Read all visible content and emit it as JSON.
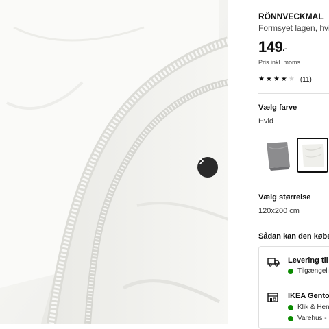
{
  "product": {
    "name": "RÖNNVECKMAL",
    "description": "Formsyet lagen, hvid",
    "price_integer": "149",
    "price_decimal": ".-",
    "vat_note": "Pris inkl. moms",
    "rating_value": 4,
    "rating_max": 5,
    "review_count": "(11)"
  },
  "color": {
    "heading": "Vælg farve",
    "selected": "Hvid",
    "swatches": [
      {
        "name": "grey-swatch",
        "color": "#8a8a8c",
        "selected": false
      },
      {
        "name": "white-swatch",
        "color": "#f1f1ee",
        "selected": true
      }
    ]
  },
  "size": {
    "heading": "Vælg størrelse",
    "selected": "120x200 cm"
  },
  "availability": {
    "heading": "Sådan kan den købes",
    "delivery_title": "Levering til",
    "delivery_status": "Tilgængelig",
    "store_title": "IKEA Gentofte",
    "store_line1": "Klik & Hent",
    "store_line2": "Varehus - På lager",
    "status_color": "#0a8a00"
  },
  "gallery": {
    "next_icon": "chevron-right-icon"
  }
}
